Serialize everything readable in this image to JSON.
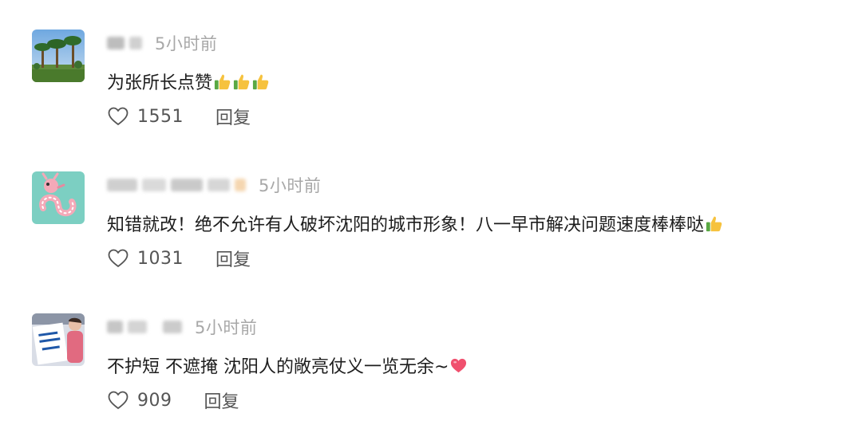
{
  "comments": [
    {
      "time": "5小时前",
      "text": "为张所长点赞",
      "emoji": [
        "thumbs-up",
        "thumbs-up",
        "thumbs-up"
      ],
      "likes": "1551",
      "reply_label": "回复",
      "avatar": "palm-trees-photo"
    },
    {
      "time": "5小时前",
      "text": "知错就改！绝不允许有人破坏沈阳的城市形象！八一早市解决问题速度棒棒哒",
      "emoji": [
        "thumbs-up"
      ],
      "likes": "1031",
      "reply_label": "回复",
      "avatar": "pink-dragon-photo"
    },
    {
      "time": "5小时前",
      "text": "不护短 不遮掩 沈阳人的敞亮仗义一览无余~",
      "emoji": [
        "red-heart"
      ],
      "likes": "909",
      "reply_label": "回复",
      "avatar": "person-with-sign-photo"
    }
  ],
  "colors": {
    "time": "#a8a8a8",
    "text": "#1d1d1d",
    "action": "#555555",
    "thumb": "#f6c23e",
    "heart": "#f0506e"
  }
}
